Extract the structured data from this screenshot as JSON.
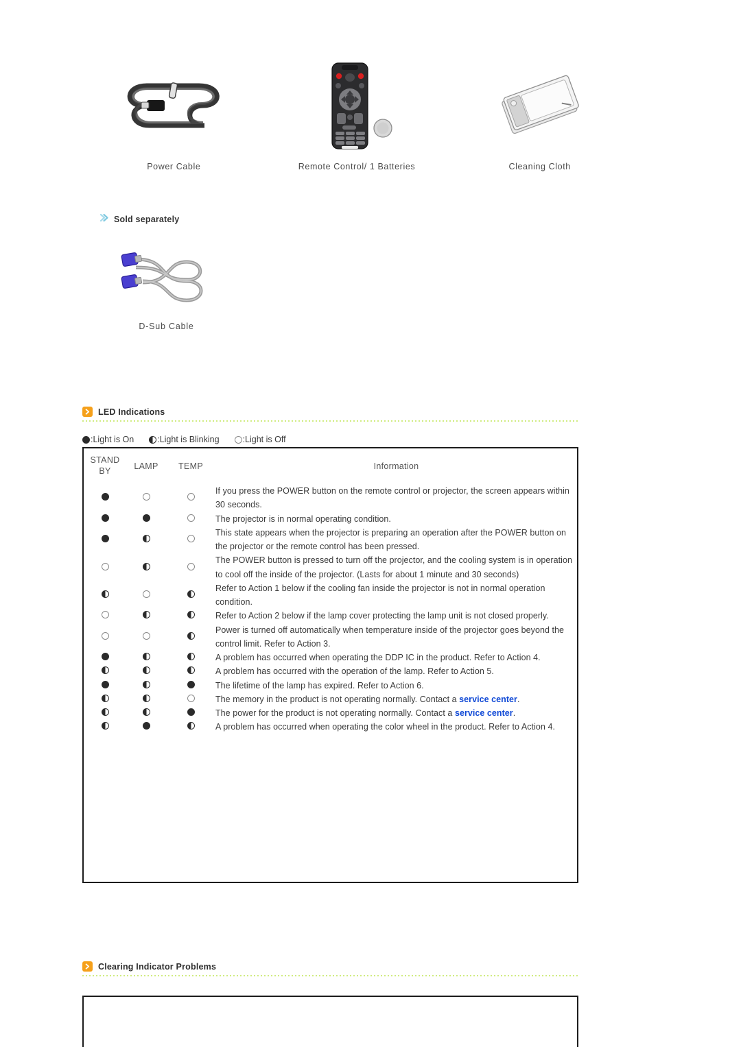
{
  "accessories": {
    "items": [
      {
        "label": "Power Cable",
        "icon": "power-cable-image"
      },
      {
        "label": "Remote Control/ 1 Batteries",
        "icon": "remote-control-image"
      },
      {
        "label": "Cleaning Cloth",
        "icon": "cleaning-cloth-image"
      }
    ]
  },
  "sold_separately": {
    "heading": "Sold separately",
    "bullet_icon": "double-chevron-icon",
    "bullet_color": "#9fd7e8",
    "item": {
      "label": "D-Sub Cable",
      "icon": "d-sub-cable-image"
    }
  },
  "sections": {
    "led_indications": {
      "title": "LED Indications",
      "icon": "orange-chevron-icon"
    },
    "clearing_indicator_problems": {
      "title": "Clearing Indicator Problems",
      "icon": "orange-chevron-icon"
    }
  },
  "colors": {
    "section_icon": "#f5a01b",
    "rule": "#c7e86a",
    "link": "#1049d6",
    "lamp_on": "#2b2b2b"
  },
  "legend": {
    "entries": [
      {
        "state": "on",
        "text": ":Light is On"
      },
      {
        "state": "blink",
        "text": ":Light is Blinking"
      },
      {
        "state": "off",
        "text": ":Light is Off"
      }
    ]
  },
  "led_table": {
    "headers": {
      "standby_line1": "STAND",
      "standby_line2": "BY",
      "lamp": "LAMP",
      "temp": "TEMP",
      "information": "Information"
    },
    "rows": [
      {
        "standby": "on",
        "lamp": "off",
        "temp": "off",
        "information": "If you press the POWER button on the remote control or projector, the screen appears within 30 seconds."
      },
      {
        "standby": "on",
        "lamp": "on",
        "temp": "off",
        "information": "The projector is in normal operating condition."
      },
      {
        "standby": "on",
        "lamp": "blink",
        "temp": "off",
        "information": "This state appears when the projector is preparing an operation after the POWER button on the projector or the remote control has been pressed."
      },
      {
        "standby": "off",
        "lamp": "blink",
        "temp": "off",
        "information": "The POWER button is pressed to turn off the projector, and the cooling system is in operation to cool off the inside of the projector. (Lasts for about 1 minute and 30 seconds)"
      },
      {
        "standby": "blink",
        "lamp": "off",
        "temp": "blink",
        "information": "Refer to Action 1 below if the cooling fan inside the projector is not in normal operation condition."
      },
      {
        "standby": "off",
        "lamp": "blink",
        "temp": "blink",
        "information": "Refer to Action 2 below if the lamp cover protecting the lamp unit is not closed properly."
      },
      {
        "standby": "off",
        "lamp": "off",
        "temp": "blink",
        "information": "Power is turned off automatically when temperature inside of the projector goes beyond the control limit. Refer to Action 3."
      },
      {
        "standby": "on",
        "lamp": "blink",
        "temp": "blink",
        "information": "A problem has occurred when operating the DDP IC in the product. Refer to Action 4."
      },
      {
        "standby": "blink",
        "lamp": "blink",
        "temp": "blink",
        "information": "A problem has occurred with the operation of the lamp. Refer to Action 5."
      },
      {
        "standby": "on",
        "lamp": "blink",
        "temp": "on",
        "information": "The lifetime of the lamp has expired. Refer to Action 6."
      },
      {
        "standby": "blink",
        "lamp": "blink",
        "temp": "off",
        "information": "The memory in the product is not operating normally. Contact a ",
        "link_text": "service center",
        "information_tail": "."
      },
      {
        "standby": "blink",
        "lamp": "blink",
        "temp": "on",
        "information": "The power for the product is not operating normally. Contact a ",
        "link_text": "service center",
        "information_tail": "."
      },
      {
        "standby": "blink",
        "lamp": "on",
        "temp": "blink",
        "information": "A problem has occurred when operating the color wheel in the product. Refer to Action 4."
      }
    ]
  }
}
